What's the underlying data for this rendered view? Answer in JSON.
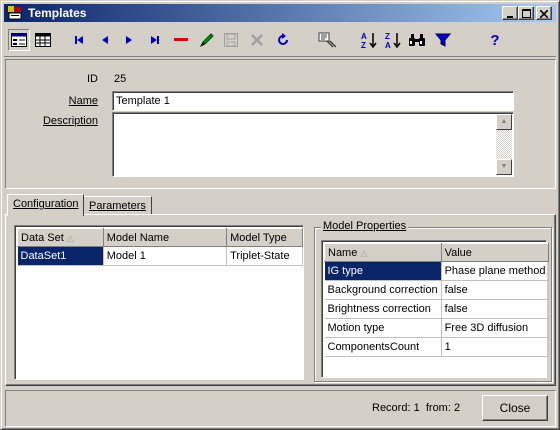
{
  "window": {
    "title": "Templates"
  },
  "toolbar": {
    "items": [
      "form-view",
      "grid-view",
      "first",
      "prev",
      "next",
      "last",
      "delete",
      "edit",
      "save",
      "cancel",
      "refresh",
      "filter-edit",
      "sort-asc",
      "sort-desc",
      "find",
      "filter",
      "help"
    ],
    "help_label": "?"
  },
  "form": {
    "id_label": "ID",
    "id_value": "25",
    "name_label": "Name",
    "name_value": "Template 1",
    "description_label": "Description",
    "description_value": ""
  },
  "tabs": [
    {
      "label": "Configuration",
      "active": true
    },
    {
      "label": "Parameters",
      "active": false
    }
  ],
  "datasets": {
    "columns": [
      "Data Set",
      "Model Name",
      "Model Type"
    ],
    "rows": [
      [
        "DataSet1",
        "Model 1",
        "Triplet-State"
      ]
    ]
  },
  "model_properties": {
    "title": "Model Properties",
    "columns": [
      "Name",
      "Value"
    ],
    "rows": [
      [
        "IG type",
        "Phase plane method"
      ],
      [
        "Background correction",
        "false"
      ],
      [
        "Brightness correction",
        "false"
      ],
      [
        "Motion type",
        "Free 3D diffusion"
      ],
      [
        "ComponentsCount",
        "1"
      ]
    ]
  },
  "status": {
    "record_label": "Record:",
    "record_value": "1",
    "from_label": "from:",
    "from_value": "2"
  },
  "buttons": {
    "close": "Close"
  },
  "colors": {
    "selection": "#0a246a",
    "title_start": "#0a246a",
    "title_end": "#a6caf0",
    "face": "#d4d0c8"
  }
}
